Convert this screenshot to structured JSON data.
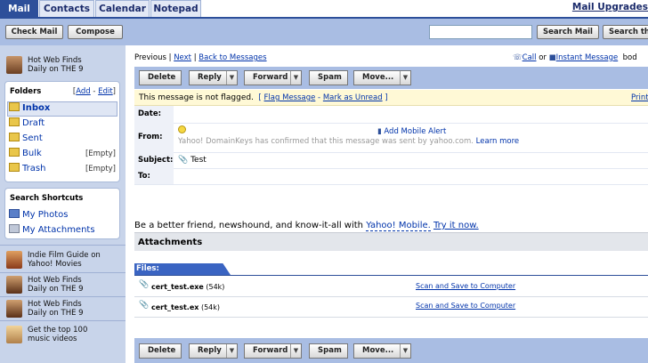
{
  "tabs": [
    {
      "label": "Mail",
      "active": true
    },
    {
      "label": "Contacts",
      "active": false
    },
    {
      "label": "Calendar",
      "active": false
    },
    {
      "label": "Notepad",
      "active": false
    }
  ],
  "mail_upgrades": "Mail Upgrades",
  "toolbar": {
    "check_mail": "Check Mail",
    "compose": "Compose",
    "search_mail": "Search Mail",
    "search_web": "Search th"
  },
  "sidebar": {
    "ad_top": "Hot Web Finds Daily on THE 9",
    "folders_title": "Folders",
    "add": "Add",
    "edit": "Edit",
    "folders": [
      {
        "name": "Inbox",
        "extra": ""
      },
      {
        "name": "Draft",
        "extra": ""
      },
      {
        "name": "Sent",
        "extra": ""
      },
      {
        "name": "Bulk",
        "extra": "[Empty]"
      },
      {
        "name": "Trash",
        "extra": "[Empty]"
      }
    ],
    "shortcuts_title": "Search Shortcuts",
    "shortcuts": [
      "My Photos",
      "My Attachments"
    ],
    "ads": [
      "Indie Film Guide on Yahoo! Movies",
      "Hot Web Finds Daily on THE 9",
      "Hot Web Finds Daily on THE 9",
      "Get the top 100 music videos"
    ]
  },
  "nav": {
    "previous": "Previous",
    "next": "Next",
    "back": "Back to Messages",
    "call": "Call",
    "or": "or",
    "im": "Instant Message",
    "body": "bod"
  },
  "actions": {
    "delete": "Delete",
    "reply": "Reply",
    "forward": "Forward",
    "spam": "Spam",
    "move": "Move..."
  },
  "flag": {
    "text": "This message is not flagged.",
    "flag_link": "Flag Message",
    "unread_link": "Mark as Unread",
    "print": "Print"
  },
  "headers": {
    "date_label": "Date:",
    "from_label": "From:",
    "subject_label": "Subject:",
    "to_label": "To:",
    "add_mobile_alert": "Add Mobile Alert",
    "domainkeys": "Yahoo! DomainKeys has confirmed that this message was sent by yahoo.com.",
    "learn_more": "Learn more",
    "subject": "Test"
  },
  "promo": {
    "text": "Be a better friend, newshound, and know-it-all with",
    "link1": "Yahoo! Mobile.",
    "link2": "Try it now."
  },
  "attachments": {
    "title": "Attachments",
    "files_label": "Files:",
    "files": [
      {
        "name": "cert_test.exe",
        "size": "(54k)",
        "action": "Scan and Save to Computer"
      },
      {
        "name": "cert_test.ex",
        "size": "(54k)",
        "action": "Scan and Save to Computer"
      }
    ]
  }
}
